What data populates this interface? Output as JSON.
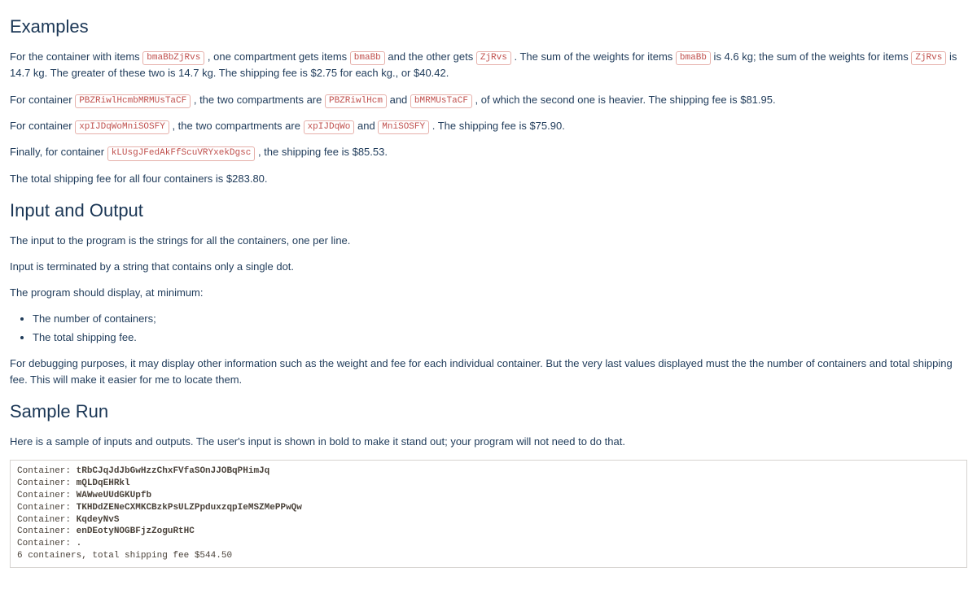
{
  "headings": {
    "examples": "Examples",
    "io": "Input and Output",
    "sample": "Sample Run"
  },
  "ex": {
    "p1_a": "For the container with items ",
    "c1": "bmaBbZjRvs",
    "p1_b": " , one compartment gets items ",
    "c2": "bmaBb",
    "p1_c": " and the other gets ",
    "c3": "ZjRvs",
    "p1_d": " . The sum of the weights for items ",
    "c4": "bmaBb",
    "p1_e": " is 4.6 kg; the sum of the weights for items ",
    "c5": "ZjRvs",
    "p1_f": " is 14.7 kg. The greater of these two is 14.7 kg. The shipping fee is $2.75 for each kg., or $40.42.",
    "p2_a": "For container ",
    "c6": "PBZRiwlHcmbMRMUsTaCF",
    "p2_b": " , the two compartments are ",
    "c7": "PBZRiwlHcm",
    "p2_c": " and ",
    "c8": "bMRMUsTaCF",
    "p2_d": " , of which the second one is heavier. The shipping fee is $81.95.",
    "p3_a": "For container ",
    "c9": "xpIJDqWoMniSOSFY",
    "p3_b": " , the two compartments are ",
    "c10": "xpIJDqWo",
    "p3_c": " and ",
    "c11": "MniSOSFY",
    "p3_d": " . The shipping fee is $75.90.",
    "p4_a": "Finally, for container ",
    "c12": "kLUsgJFedAkFfScuVRYxekDgsc",
    "p4_b": " , the shipping fee is $85.53.",
    "p5": "The total shipping fee for all four containers is $283.80."
  },
  "io": {
    "p1": "The input to the program is the strings for all the containers, one per line.",
    "p2": "Input is terminated by a string that contains only a single dot.",
    "p3": "The program should display, at minimum:",
    "li1": "The number of containers;",
    "li2": "The total shipping fee.",
    "p4": "For debugging purposes, it may display other information such as the weight and fee for each individual container. But the very last values displayed must the the number of containers and total shipping fee. This will make it easier for me to locate them."
  },
  "sample": {
    "intro": "Here is a sample of inputs and outputs. The user's input is shown in bold to make it stand out; your program will not need to do that.",
    "prompt": "Container: ",
    "in1": "tRbCJqJdJbGwHzzChxFVfaSOnJJOBqPHimJq",
    "in2": "mQLDqEHRkl",
    "in3": "WAWweUUdGKUpfb",
    "in4": "TKHDdZENeCXMKCBzkPsULZPpduxzqpIeMSZMePPwQw",
    "in5": "KqdeyNvS",
    "in6": "enDEotyNOGBFjzZoguRtHC",
    "in7": ".",
    "result": "6 containers, total shipping fee $544.50"
  }
}
